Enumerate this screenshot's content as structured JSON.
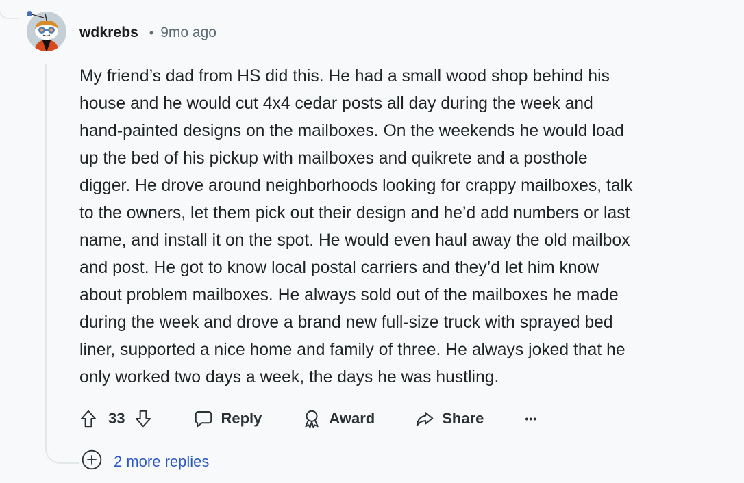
{
  "comment": {
    "username": "wdkrebs",
    "separator": "•",
    "timestamp": "9mo ago",
    "avatar_icon": "snoo-avatar-icon",
    "body": "My friend’s dad from HS did this. He had a small wood shop behind his\nhouse and he would cut 4x4 cedar posts all day during the week and\nhand-painted designs on the mailboxes. On the weekends he would load\nup the bed of his pickup with mailboxes and quikrete and a posthole\ndigger. He drove around neighborhoods looking for crappy mailboxes, talk\nto the owners, let them pick out their design and he’d add numbers or last\nname, and install it on the spot. He would even haul away the old mailbox\nand post. He got to know local postal carriers and they’d let him know\nabout problem mailboxes. He always sold out of the mailboxes he made\nduring the week and drove a brand new full-size truck with sprayed bed\nliner, supported a nice home and family of three. He always joked that he\nonly worked two days a week, the days he was hustling."
  },
  "actions": {
    "vote_count": "33",
    "reply_label": "Reply",
    "award_label": "Award",
    "share_label": "Share",
    "more_label": "•••"
  },
  "more_replies": {
    "label": "2 more replies"
  },
  "colors": {
    "background": "#f8f9fb",
    "text": "#1f2427",
    "muted": "#5c6c74",
    "link": "#2b58c4",
    "thread_line": "#e2e7ea"
  }
}
